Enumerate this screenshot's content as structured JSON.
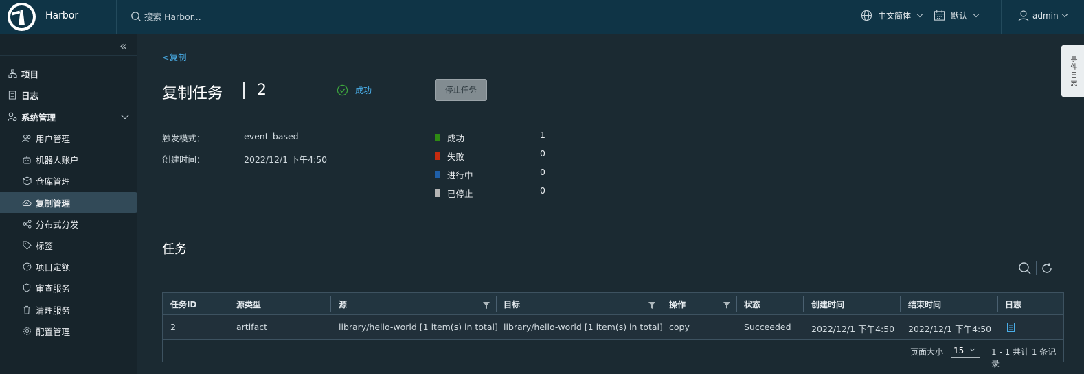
{
  "header": {
    "brand": "Harbor",
    "search_placeholder": "搜索 Harbor...",
    "language": "中文简体",
    "theme": "默认",
    "user": "admin"
  },
  "sidebar": {
    "items": [
      {
        "label": "项目"
      },
      {
        "label": "日志"
      },
      {
        "label": "系统管理"
      }
    ],
    "sub_items": [
      {
        "label": "用户管理"
      },
      {
        "label": "机器人账户"
      },
      {
        "label": "仓库管理"
      },
      {
        "label": "复制管理"
      },
      {
        "label": "分布式分发"
      },
      {
        "label": "标签"
      },
      {
        "label": "项目定额"
      },
      {
        "label": "审查服务"
      },
      {
        "label": "清理服务"
      },
      {
        "label": "配置管理"
      }
    ]
  },
  "main": {
    "back_link": "<复制",
    "title": "复制任务",
    "execution_id": "2",
    "status": "成功",
    "stop_button": "停止任务",
    "trigger_label": "触发模式：",
    "trigger_value": "event_based",
    "created_label": "创建时间：",
    "created_value": "2022/12/1 下午4:50",
    "legend": [
      {
        "label": "成功",
        "value": "1",
        "color": "#2e8a13"
      },
      {
        "label": "失败",
        "value": "0",
        "color": "#c42b0f"
      },
      {
        "label": "进行中",
        "value": "0",
        "color": "#1f5fa8"
      },
      {
        "label": "已停止",
        "value": "0",
        "color": "#b5b5b5"
      }
    ],
    "section_title": "任务"
  },
  "table": {
    "columns": [
      "任务ID",
      "源类型",
      "源",
      "目标",
      "操作",
      "状态",
      "创建时间",
      "结束时间",
      "日志"
    ],
    "rows": [
      {
        "id": "2",
        "source_type": "artifact",
        "source": "library/hello-world [1 item(s) in total]",
        "target": "library/hello-world [1 item(s) in total]",
        "operation": "copy",
        "status": "Succeeded",
        "created": "2022/12/1 下午4:50",
        "ended": "2022/12/1 下午4:50"
      }
    ],
    "page_size_label": "页面大小",
    "page_size": "15",
    "summary": "1 - 1 共计 1 条记录"
  },
  "side_tab": "事件日志"
}
